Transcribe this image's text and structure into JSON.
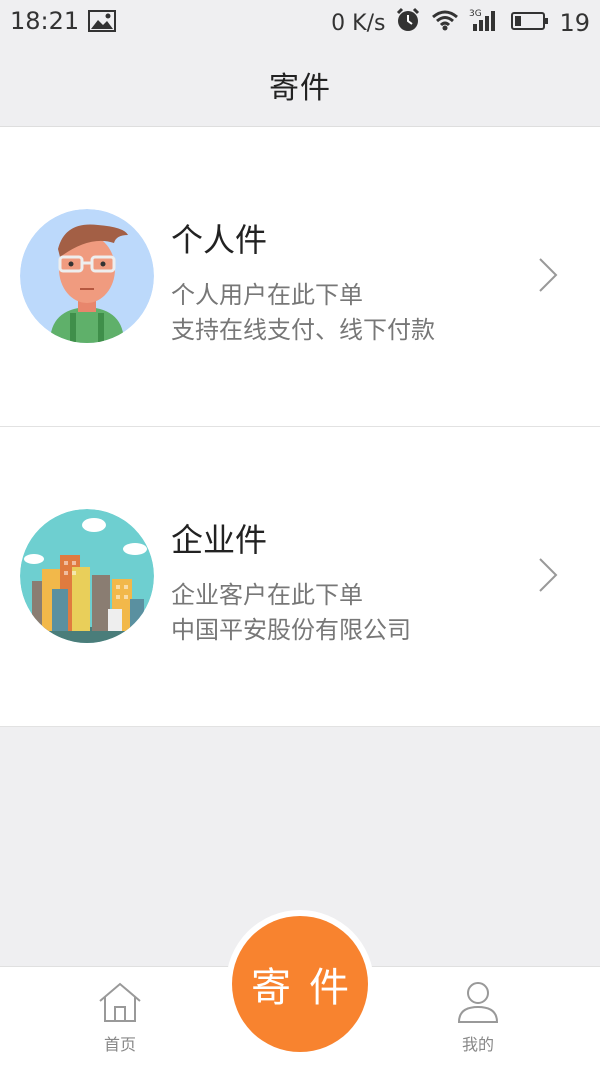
{
  "status_bar": {
    "time": "18:21",
    "net_speed": "0 K/s",
    "network": "3G",
    "battery": "19"
  },
  "header": {
    "title": "寄件"
  },
  "options": [
    {
      "title": "个人件",
      "line1": "个人用户在此下单",
      "line2": "支持在线支付、线下付款",
      "icon": "person-avatar-icon"
    },
    {
      "title": "企业件",
      "line1": "企业客户在此下单",
      "line2": "中国平安股份有限公司",
      "icon": "city-buildings-icon"
    }
  ],
  "tab_bar": {
    "home_label": "首页",
    "send_label": "寄件",
    "mine_label": "我的"
  },
  "colors": {
    "accent": "#f8832f",
    "background": "#efeff1",
    "secondary_text": "#777777"
  }
}
